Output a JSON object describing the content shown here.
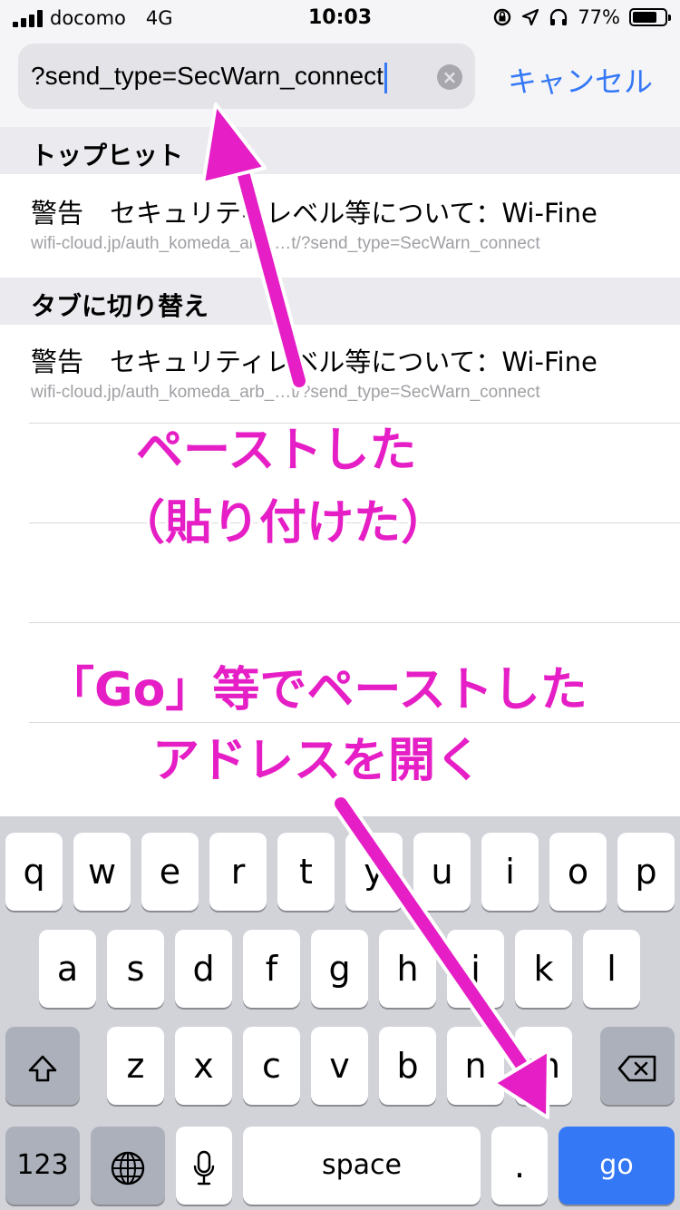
{
  "status_bar": {
    "carrier": "docomo",
    "network": "4G",
    "time": "10:03",
    "battery": "77%",
    "battery_level": 0.77
  },
  "search": {
    "value": "?send_type=SecWarn_connect",
    "cancel_label": "キャンセル"
  },
  "sections": {
    "top_hit": {
      "header": "トップヒット",
      "title": "警告　セキュリティレベル等について：Wi-Fine",
      "url": "wifi-cloud.jp/auth_komeda_arb_…t/?send_type=SecWarn_connect"
    },
    "switch_tab": {
      "header": "タブに切り替え",
      "title": "警告　セキュリティレベル等について：Wi-Fine",
      "url": "wifi-cloud.jp/auth_komeda_arb_…t/?send_type=SecWarn_connect"
    }
  },
  "annotations": {
    "pasted_line1": "ペーストした",
    "pasted_line2": "（貼り付けた）",
    "go_line1": "「Go」等でペーストした",
    "go_line2": "アドレスを開く"
  },
  "keyboard": {
    "row1": [
      "q",
      "w",
      "e",
      "r",
      "t",
      "y",
      "u",
      "i",
      "o",
      "p"
    ],
    "row2": [
      "a",
      "s",
      "d",
      "f",
      "g",
      "h",
      "j",
      "k",
      "l"
    ],
    "row3": [
      "z",
      "x",
      "c",
      "v",
      "b",
      "n",
      "m"
    ],
    "numbers_label": "123",
    "space_label": "space",
    "period_label": ".",
    "go_label": "go",
    "shift_icon": "shift-icon",
    "delete_icon": "delete-icon",
    "globe_icon": "globe-icon",
    "mic_icon": "microphone-icon"
  },
  "colors": {
    "accent": "#3478f6",
    "annotation": "#e51ec5"
  }
}
